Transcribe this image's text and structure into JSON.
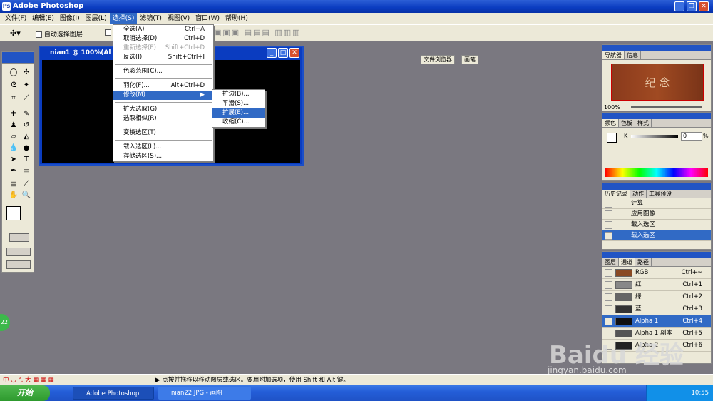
{
  "app": {
    "title": "Adobe Photoshop",
    "logo": "Ps"
  },
  "menubar": [
    "文件(F)",
    "编辑(E)",
    "图像(I)",
    "图层(L)",
    "选择(S)",
    "滤镜(T)",
    "视图(V)",
    "窗口(W)",
    "帮助(H)"
  ],
  "options": {
    "auto_select": "自动选择图层",
    "file_browser": "文件浏览器",
    "brushes": "画笔"
  },
  "image_window": {
    "title": "nian1 @ 100%(Al"
  },
  "select_menu": [
    {
      "label": "全选(A)",
      "shortcut": "Ctrl+A"
    },
    {
      "label": "取消选择(D)",
      "shortcut": "Ctrl+D"
    },
    {
      "label": "重新选择(E)",
      "shortcut": "Shift+Ctrl+D",
      "disabled": true
    },
    {
      "label": "反选(I)",
      "shortcut": "Shift+Ctrl+I"
    },
    {
      "sep": true
    },
    {
      "label": "色彩范围(C)...",
      "shortcut": ""
    },
    {
      "sep": true
    },
    {
      "label": "羽化(F)...",
      "shortcut": "Alt+Ctrl+D"
    },
    {
      "label": "修改(M)",
      "shortcut": "▶",
      "highlight": true
    },
    {
      "sep": true
    },
    {
      "label": "扩大选取(G)",
      "shortcut": ""
    },
    {
      "label": "选取相似(R)",
      "shortcut": ""
    },
    {
      "sep": true
    },
    {
      "label": "变换选区(T)",
      "shortcut": ""
    },
    {
      "sep": true
    },
    {
      "label": "载入选区(L)...",
      "shortcut": ""
    },
    {
      "label": "存储选区(S)...",
      "shortcut": ""
    }
  ],
  "modify_menu": [
    {
      "label": "扩边(B)..."
    },
    {
      "label": "平滑(S)..."
    },
    {
      "label": "扩展(E)...",
      "highlight": true
    },
    {
      "label": "收缩(C)..."
    }
  ],
  "navigator": {
    "tabs": [
      "导航器",
      "信息"
    ],
    "zoom": "100%",
    "thumb_text": "纪 念"
  },
  "color": {
    "tabs": [
      "颜色",
      "色板",
      "样式"
    ],
    "channel": "K",
    "value": "0",
    "unit": "%"
  },
  "history": {
    "tabs": [
      "历史记录",
      "动作",
      "工具预设"
    ],
    "items": [
      "计算",
      "应用图像",
      "载入选区",
      "载入选区"
    ],
    "selected": 3
  },
  "channels": {
    "tabs": [
      "图层",
      "通道",
      "路径"
    ],
    "rows": [
      {
        "name": "RGB",
        "shortcut": "Ctrl+~"
      },
      {
        "name": "红",
        "shortcut": "Ctrl+1"
      },
      {
        "name": "绿",
        "shortcut": "Ctrl+2"
      },
      {
        "name": "蓝",
        "shortcut": "Ctrl+3"
      },
      {
        "name": "Alpha 1",
        "shortcut": "Ctrl+4",
        "selected": true
      },
      {
        "name": "Alpha 1 副本",
        "shortcut": "Ctrl+5"
      },
      {
        "name": "Alpha 2",
        "shortcut": "Ctrl+6"
      }
    ]
  },
  "status": {
    "hint": "点按并拖移以移动图层或选区。要用附加选项，使用 Shift 和 Alt 键。",
    "ime": "中 ◡ °, 大 ▦ ▦ ▦"
  },
  "taskbar": {
    "start": "开始",
    "tasks": [
      "Adobe Photoshop",
      "nian22.JPG - 画图"
    ],
    "clock": "10:55",
    "badge": "22"
  },
  "watermark": {
    "text": "Baidu 经验",
    "url": "jingyan.baidu.com"
  }
}
